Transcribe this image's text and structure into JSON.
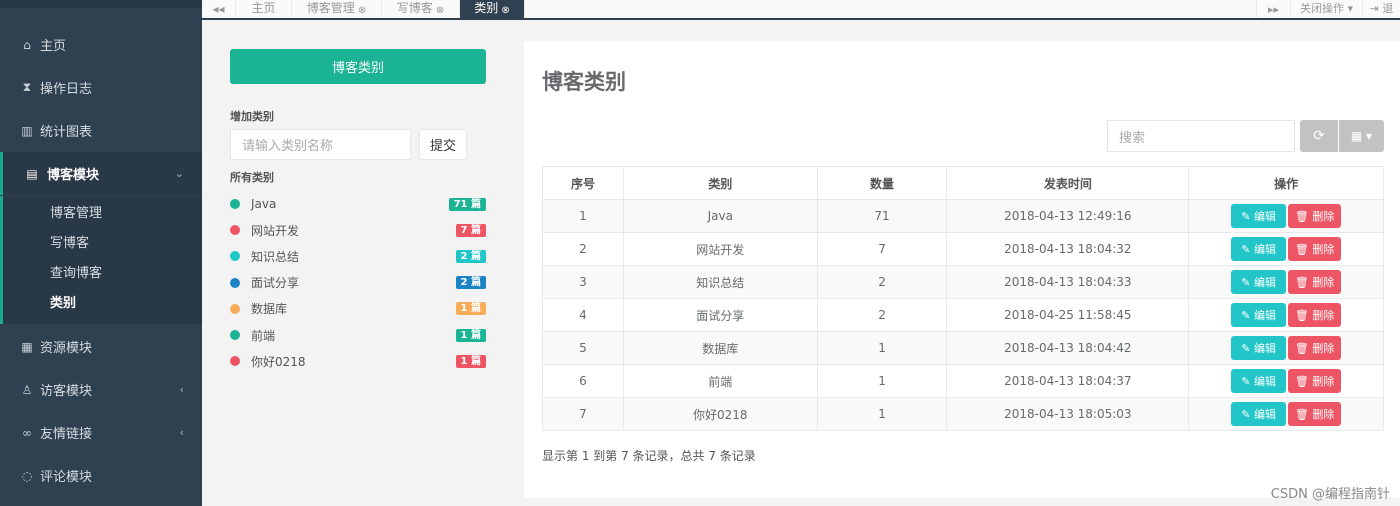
{
  "sidebar": {
    "items": [
      {
        "label": "主页",
        "icon": "home-icon",
        "glyph": "⌂"
      },
      {
        "label": "操作日志",
        "icon": "hourglass-icon",
        "glyph": "⧗"
      },
      {
        "label": "统计图表",
        "icon": "bar-chart-icon",
        "glyph": "▥"
      },
      {
        "label": "博客模块",
        "icon": "book-icon",
        "glyph": "▤"
      },
      {
        "label": "资源模块",
        "icon": "table-icon",
        "glyph": "▦"
      },
      {
        "label": "访客模块",
        "icon": "user-icon",
        "glyph": "♙"
      },
      {
        "label": "友情链接",
        "icon": "link-icon",
        "glyph": "∞"
      },
      {
        "label": "评论模块",
        "icon": "comment-icon",
        "glyph": "◌"
      }
    ],
    "submenu": [
      "博客管理",
      "写博客",
      "查询博客",
      "类别"
    ],
    "expand_arrow": "⌄",
    "collapse_arrow": "‹"
  },
  "tabs": {
    "items": [
      {
        "label": "主页"
      },
      {
        "label": "博客管理",
        "close": "⊗"
      },
      {
        "label": "写博客",
        "close": "⊗"
      },
      {
        "label": "类别",
        "close": "⊗"
      }
    ],
    "prev": "◂◂",
    "next": "▸▸",
    "close_ops": "关闭操作 ▾",
    "logout": "⇥ 退"
  },
  "left_panel": {
    "header_button": "博客类别",
    "add_label": "增加类别",
    "input_placeholder": "请输入类别名称",
    "submit": "提交",
    "all_label": "所有类别",
    "categories": [
      {
        "name": "Java",
        "count": "71 篇",
        "color": "#1ab394"
      },
      {
        "name": "网站开发",
        "count": "7 篇",
        "color": "#ed5565"
      },
      {
        "name": "知识总结",
        "count": "2 篇",
        "color": "#23c6c8"
      },
      {
        "name": "面试分享",
        "count": "2 篇",
        "color": "#1c84c6"
      },
      {
        "name": "数据库",
        "count": "1 篇",
        "color": "#f8ac59"
      },
      {
        "name": "前端",
        "count": "1 篇",
        "color": "#1ab394"
      },
      {
        "name": "你好0218",
        "count": "1 篇",
        "color": "#ed5565"
      }
    ]
  },
  "main": {
    "title": "博客类别",
    "search_placeholder": "搜索",
    "refresh_icon": "⟳",
    "columns_icon": "▦ ▾",
    "columns": [
      "序号",
      "类别",
      "数量",
      "发表时间",
      "操作"
    ],
    "rows": [
      {
        "id": "1",
        "category": "Java",
        "count": "71",
        "time": "2018-04-13 12:49:16"
      },
      {
        "id": "2",
        "category": "网站开发",
        "count": "7",
        "time": "2018-04-13 18:04:32"
      },
      {
        "id": "3",
        "category": "知识总结",
        "count": "2",
        "time": "2018-04-13 18:04:33"
      },
      {
        "id": "4",
        "category": "面试分享",
        "count": "2",
        "time": "2018-04-25 11:58:45"
      },
      {
        "id": "5",
        "category": "数据库",
        "count": "1",
        "time": "2018-04-13 18:04:42"
      },
      {
        "id": "6",
        "category": "前端",
        "count": "1",
        "time": "2018-04-13 18:04:37"
      },
      {
        "id": "7",
        "category": "你好0218",
        "count": "1",
        "time": "2018-04-13 18:05:03"
      }
    ],
    "edit_label": "✎ 编辑",
    "delete_label": "🗑 删除",
    "footer": "显示第 1 到第 7 条记录，总共 7 条记录"
  },
  "watermark": "CSDN @编程指南针",
  "colors": {
    "accent": "#1ab394",
    "sidebar": "#2f4050",
    "edit": "#23c6c8",
    "delete": "#ed5565"
  }
}
